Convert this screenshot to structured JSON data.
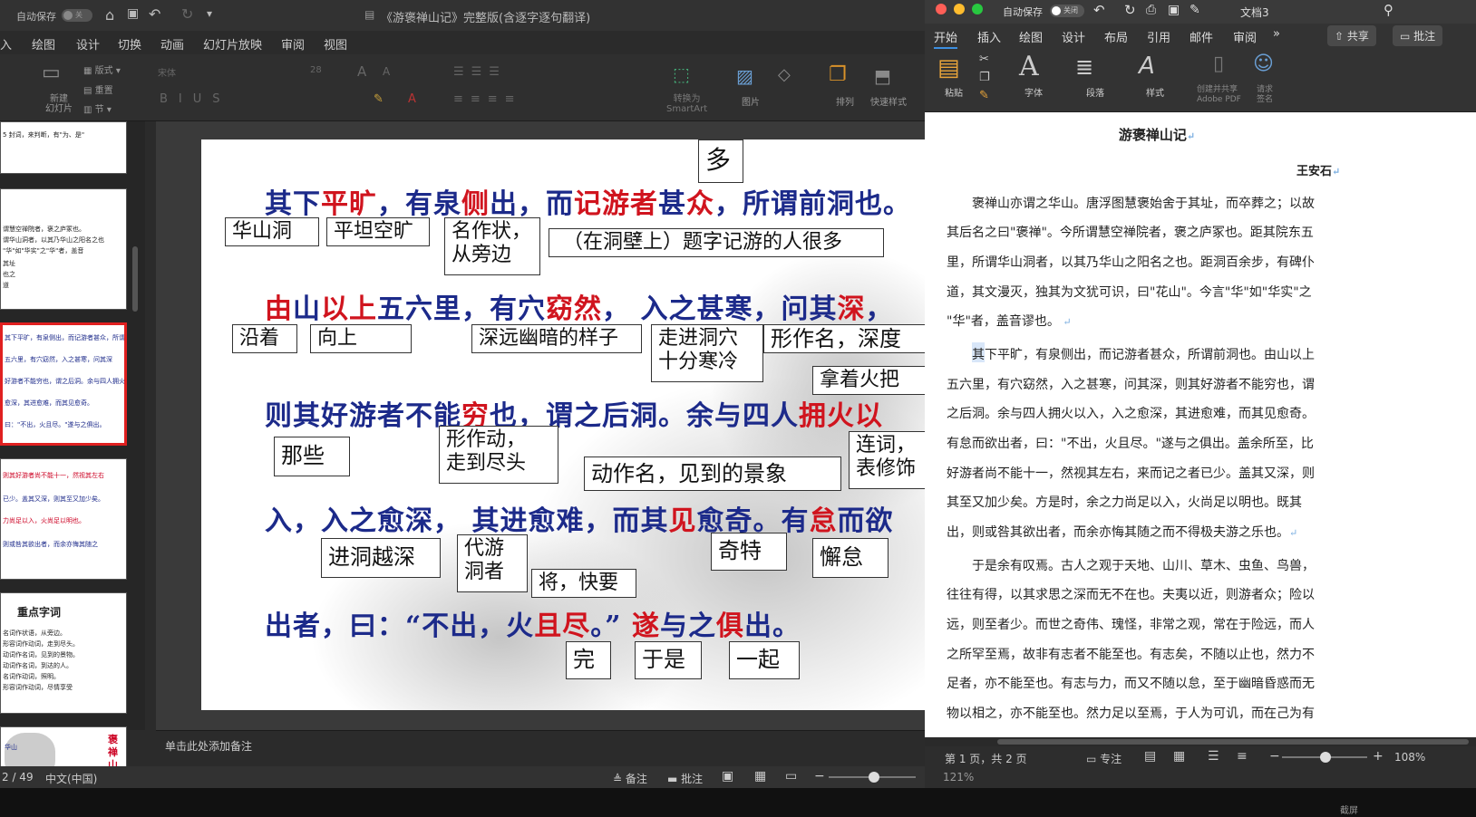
{
  "ppt": {
    "autosave_label": "自动保存",
    "autosave_state": "关",
    "window_title": "《游褒禅山记》完整版(含逐字逐句翻译)",
    "tabs": [
      "入",
      "绘图",
      "设计",
      "切换",
      "动画",
      "幻灯片放映",
      "审阅",
      "视图"
    ],
    "ribbon": {
      "new_slide": "新建\n幻灯片",
      "layout": "版式",
      "reset": "重置",
      "section": "节",
      "font_name": "宋体",
      "font_size": "28",
      "convert_smartart": "转换为\nSmartArt",
      "picture": "图片",
      "arrange": "排列",
      "quick_styles": "快速样式"
    },
    "notes_placeholder": "单击此处添加备注",
    "status": {
      "slide_count": "2 / 49",
      "language": "中文(中国)",
      "notes_btn": "备注",
      "comments_btn": "批注",
      "zoom": "121%"
    }
  },
  "thumbs": {
    "t1": [
      "5 封词，来判断，有\"为、是\""
    ],
    "t2": [
      "谓慧空禅院者，褒之庐冢也。",
      "谓华山洞者，以其乃华山之阳名之也",
      "\"华\"如\"华实\"之\"华\"者，盖音",
      "其址",
      "也之",
      "道"
    ],
    "t3": [
      "其下平旷，有泉侧出，而记游者甚众，所谓前洞也。",
      "五六里，有穴窈然，入之甚寒，问其深",
      "好游者不能穷也，谓之后洞。余与四人拥火以入",
      "愈深，其进愈难，而其见愈奇。",
      "曰：\"不出，火且尽。\"遂与之俱出。"
    ],
    "t4": [
      "则其好游者尚不能十一，然视其左右",
      "已少。盖其又深，则其至又加少矣。",
      "力尚足以入，火尚足以明也。",
      "则或咎其欲出者，而余亦悔其随之"
    ],
    "t5_title": "重点字词",
    "t5": [
      "名词作状语，从旁边。",
      "形容词作动词，走到尽头。",
      "动词作名词，见到的景物。",
      "动词作名词，到达的人。",
      "名词作动词，照明。",
      "形容词作动词，尽情享受"
    ],
    "t6": [
      "华山",
      "褒",
      "禅",
      "山"
    ]
  },
  "slide": {
    "top_box": "多",
    "line1": [
      {
        "t": "其",
        "c": "nv"
      },
      {
        "t": "下",
        "c": "nv"
      },
      {
        "t": "平旷",
        "c": "rd"
      },
      {
        "t": "，有泉",
        "c": "nv"
      },
      {
        "t": "侧",
        "c": "rd"
      },
      {
        "t": "出，而",
        "c": "nv"
      },
      {
        "t": "记游者",
        "c": "rd"
      },
      {
        "t": "甚",
        "c": "nv"
      },
      {
        "t": "众",
        "c": "rd"
      },
      {
        "t": "，所谓前洞也。",
        "c": "nv"
      }
    ],
    "line2": [
      {
        "t": "由",
        "c": "rd"
      },
      {
        "t": "山",
        "c": "nv"
      },
      {
        "t": "以上",
        "c": "rd"
      },
      {
        "t": "五六里，有穴",
        "c": "nv"
      },
      {
        "t": "窈然",
        "c": "rd"
      },
      {
        "t": "， 入之甚寒，问",
        "c": "nv"
      },
      {
        "t": "其",
        "c": "nv"
      },
      {
        "t": "深",
        "c": "rd"
      },
      {
        "t": "，",
        "c": "nv"
      }
    ],
    "line3": [
      {
        "t": "则",
        "c": "nv"
      },
      {
        "t": "其",
        "c": "nv"
      },
      {
        "t": "好游者不能",
        "c": "nv"
      },
      {
        "t": "穷",
        "c": "rd"
      },
      {
        "t": "也，谓之后洞。余与四人",
        "c": "nv"
      },
      {
        "t": "拥火",
        "c": "rd"
      },
      {
        "t": "以",
        "c": "rd"
      }
    ],
    "line4": [
      {
        "t": "入，入之愈深， ",
        "c": "nv"
      },
      {
        "t": "其",
        "c": "nv"
      },
      {
        "t": "进愈难，而其",
        "c": "nv"
      },
      {
        "t": "见",
        "c": "rd"
      },
      {
        "t": "愈奇。有",
        "c": "nv"
      },
      {
        "t": "怠",
        "c": "rd"
      },
      {
        "t": "而欲",
        "c": "nv"
      }
    ],
    "line5": [
      {
        "t": "出者，曰：“不出，火",
        "c": "nv"
      },
      {
        "t": "且尽",
        "c": "rd"
      },
      {
        "t": "。” ",
        "c": "nv"
      },
      {
        "t": "遂",
        "c": "rd"
      },
      {
        "t": "与之",
        "c": "nv"
      },
      {
        "t": "俱",
        "c": "rd"
      },
      {
        "t": "出。",
        "c": "nv"
      }
    ],
    "boxes": {
      "b_huashandong": "华山洞",
      "b_pingtan": "平坦空旷",
      "b_mingzuozhuang": "名作状，\n从旁边",
      "b_tizi": "（在洞壁上）题字记游的人很多",
      "b_yanzhe": "沿着",
      "b_xiangshang": "向上",
      "b_shenyuan": "深远幽暗的样子",
      "b_zoujin": "走进洞穴\n十分寒冷",
      "b_xingzuoming": "形作名，深度",
      "b_nazhe": "拿着火把",
      "b_naxie": "那些",
      "b_xingzuodong": "形作动，\n走到尽头",
      "b_dongzuoming": "动作名，见到的景象",
      "b_lianci": "连词，\n表修饰",
      "b_jindong": "进洞越深",
      "b_daiyou": "代游\n洞者",
      "b_jiangkuai": "将，快要",
      "b_qite": "奇特",
      "b_xiedai": "懈怠",
      "b_wan": "完",
      "b_yushi": "于是",
      "b_yiqi": "一起"
    }
  },
  "word": {
    "autosave_label": "自动保存",
    "autosave_state": "关闭",
    "doc_title": "文档3",
    "tabs": [
      "开始",
      "插入",
      "绘图",
      "设计",
      "布局",
      "引用",
      "邮件",
      "审阅"
    ],
    "share_btn": "共享",
    "comments_btn": "批注",
    "ribbon": {
      "paste": "粘贴",
      "font": "字体",
      "paragraph": "段落",
      "styles": "样式",
      "create_pdf": "创建并共享\nAdobe PDF",
      "request_sign": "请求\n签名"
    },
    "title": "游褒禅山记",
    "author": "王安石",
    "lines": [
      "褒禅山亦谓之华山。唐浮图慧褒始舍于其址，而卒葬之；以故",
      "其后名之曰\"褒禅\"。今所谓慧空禅院者，褒之庐冢也。距其院东五",
      "里，所谓华山洞者，以其乃华山之阳名之也。距洞百余步，有碑仆",
      "道，其文漫灭，独其为文犹可识，曰\"花山\"。今言\"华\"如\"华实\"之",
      "\"华\"者，盖音谬也。",
      "其下平旷，有泉侧出，而记游者甚众，所谓前洞也。由山以上",
      "五六里，有穴窈然，入之甚寒，问其深，则其好游者不能穷也，谓",
      "之后洞。余与四人拥火以入，入之愈深，其进愈难，而其见愈奇。",
      "有怠而欲出者，曰：\"不出，火且尽。\"遂与之俱出。盖余所至，比",
      "好游者尚不能十一，然视其左右，来而记之者已少。盖其又深，则",
      "其至又加少矣。方是时，余之力尚足以入，火尚足以明也。既其",
      "出，则或咎其欲出者，而余亦悔其随之而不得极夫游之乐也。",
      "于是余有叹焉。古人之观于天地、山川、草木、虫鱼、鸟兽，",
      "往往有得，以其求思之深而无不在也。夫夷以近，则游者众；险以",
      "远，则至者少。而世之奇伟、瑰怪，非常之观，常在于险远，而人",
      "之所罕至焉，故非有志者不能至也。有志矣，不随以止也，然力不",
      "足者，亦不能至也。有志与力，而又不随以怠，至于幽暗昏惑而无",
      "物以相之，亦不能至也。然力足以至焉，于人为可讥，而在己为有"
    ],
    "status": {
      "page": "第 1 页，共 2 页",
      "focus": "专注",
      "zoom": "108%"
    }
  },
  "taskbar": {
    "label": "截屏"
  }
}
